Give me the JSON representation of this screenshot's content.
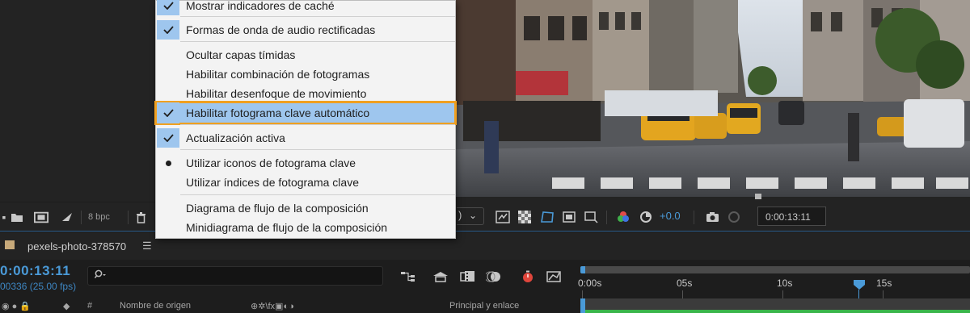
{
  "menu": {
    "items": [
      {
        "label": "Mostrar indicadores de caché",
        "state": "checked"
      },
      {
        "label": "Formas de onda de audio rectificadas",
        "state": "checked"
      },
      {
        "label": "Ocultar capas tímidas",
        "state": "none"
      },
      {
        "label": "Habilitar combinación de fotogramas",
        "state": "none"
      },
      {
        "label": "Habilitar desenfoque de movimiento",
        "state": "none"
      },
      {
        "label": "Habilitar fotograma clave automático",
        "state": "checked",
        "highlighted": true
      },
      {
        "label": "Actualización activa",
        "state": "checked"
      },
      {
        "label": "Utilizar iconos de fotograma clave",
        "state": "radio"
      },
      {
        "label": "Utilizar índices de fotograma clave",
        "state": "none"
      },
      {
        "label": "Diagrama de flujo de la composición",
        "state": "none"
      },
      {
        "label": "Minidiagrama de flujo de la composición",
        "state": "none"
      }
    ]
  },
  "viewer_toolbar": {
    "bit_depth": "8 bpc",
    "exposure": "+0.0",
    "timecode": "0:00:13:11"
  },
  "timeline": {
    "comp_name": "pexels-photo-378570",
    "menu_glyph": "☰",
    "current_time": "0:00:13:11",
    "frames": "00336 (25.00 fps)",
    "columns": {
      "hash": "#",
      "source_name": "Nombre de origen",
      "switches": "⊕✲\\fx▣◐◑",
      "parent": "Principal y enlace"
    },
    "ruler_labels": [
      "0:00s",
      "05s",
      "10s",
      "15s"
    ]
  },
  "colors": {
    "accent_blue": "#4a9ad8",
    "highlight_outline": "#f0a020",
    "menu_check_bg": "#9ec6ee",
    "track_green": "#39b54a"
  },
  "icons": [
    "folder-icon",
    "composition-icon",
    "shy-icon",
    "trash-icon",
    "snapshot-camera-icon",
    "show-snapshot-icon",
    "color-channels-icon",
    "exposure-reset-icon",
    "timer-icon",
    "motion-blur-icon",
    "draft-3d-icon",
    "frame-blending-icon",
    "graph-editor-icon"
  ]
}
